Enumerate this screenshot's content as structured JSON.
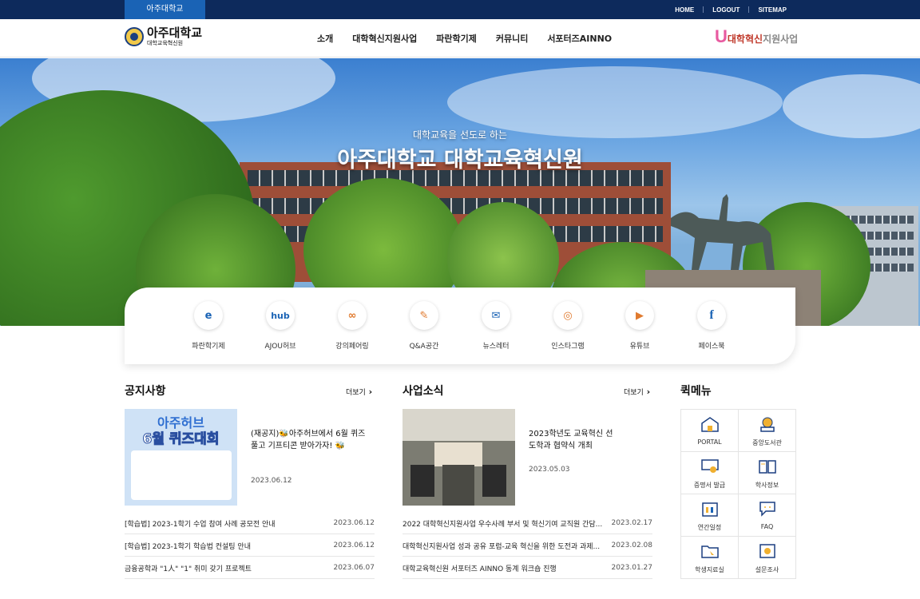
{
  "topbar": {
    "site_tab": "아주대학교",
    "links": [
      "HOME",
      "LOGOUT",
      "SITEMAP"
    ]
  },
  "header": {
    "logo_title": "아주대학교",
    "logo_sub": "대학교육혁신원",
    "nav": [
      "소개",
      "대학혁신지원사업",
      "파란학기제",
      "커뮤니티",
      "서포터즈AINNO"
    ],
    "right_logo_main": "대학혁신",
    "right_logo_sub": "지원사업"
  },
  "hero": {
    "subtitle": "대학교육을 선도로 하는",
    "title": "아주대학교 대학교육혁신원"
  },
  "quick_links": [
    {
      "label": "파란학기제",
      "icon": "blue-semester-icon"
    },
    {
      "label": "AJOU허브",
      "icon": "hub-icon"
    },
    {
      "label": "강의페어링",
      "icon": "link-icon"
    },
    {
      "label": "Q&A공간",
      "icon": "pencil-icon"
    },
    {
      "label": "뉴스레터",
      "icon": "mail-icon"
    },
    {
      "label": "인스타그램",
      "icon": "instagram-icon"
    },
    {
      "label": "유튜브",
      "icon": "youtube-icon"
    },
    {
      "label": "페이스북",
      "icon": "facebook-icon"
    }
  ],
  "notice": {
    "heading": "공지사항",
    "more": "더보기",
    "featured_title": "(재공지)🐝아주허브에서 6월 퀴즈 풀고 기프티콘 받아가자! 🐝",
    "featured_date": "2023.06.12",
    "thumb_line1": "아주허브",
    "thumb_line2": "6월 퀴즈대회",
    "items": [
      {
        "title": "[학습법] 2023-1학기 수업 참여 사례 공모전 안내",
        "date": "2023.06.12"
      },
      {
        "title": "[학습법] 2023-1학기 학습법 컨설팅 안내",
        "date": "2023.06.12"
      },
      {
        "title": "금융공학과 \"1人\" \"1\" 취미 갖기 프로젝트",
        "date": "2023.06.07"
      }
    ]
  },
  "news": {
    "heading": "사업소식",
    "more": "더보기",
    "featured_title": "2023학년도 교육혁신 선도학과 협약식 개최",
    "featured_date": "2023.05.03",
    "items": [
      {
        "title": "2022 대학혁신지원사업 우수사례 부서 및 혁신기여 교직원 간담...",
        "date": "2023.02.17"
      },
      {
        "title": "대학혁신지원사업 성과 공유 포럼-교육 혁신을 위한 도전과 과제...",
        "date": "2023.02.08"
      },
      {
        "title": "대학교육혁신원 서포터즈 AINNO 동계 워크숍 진행",
        "date": "2023.01.27"
      }
    ]
  },
  "quick_menu": {
    "heading": "퀵메뉴",
    "items": [
      {
        "label": "PORTAL",
        "icon": "school-icon"
      },
      {
        "label": "중앙도서관",
        "icon": "library-icon"
      },
      {
        "label": "증명서 발급",
        "icon": "certificate-icon"
      },
      {
        "label": "학사정보",
        "icon": "book-icon"
      },
      {
        "label": "연간일정",
        "icon": "calendar-icon"
      },
      {
        "label": "FAQ",
        "icon": "chat-icon"
      },
      {
        "label": "학생지료실",
        "icon": "folder-icon"
      },
      {
        "label": "설문조사",
        "icon": "survey-icon"
      }
    ]
  },
  "colors": {
    "topbar": "#0d2a5c",
    "accent": "#1a63b5",
    "brand_pink": "#e85aa0",
    "brand_red": "#c0392b"
  }
}
